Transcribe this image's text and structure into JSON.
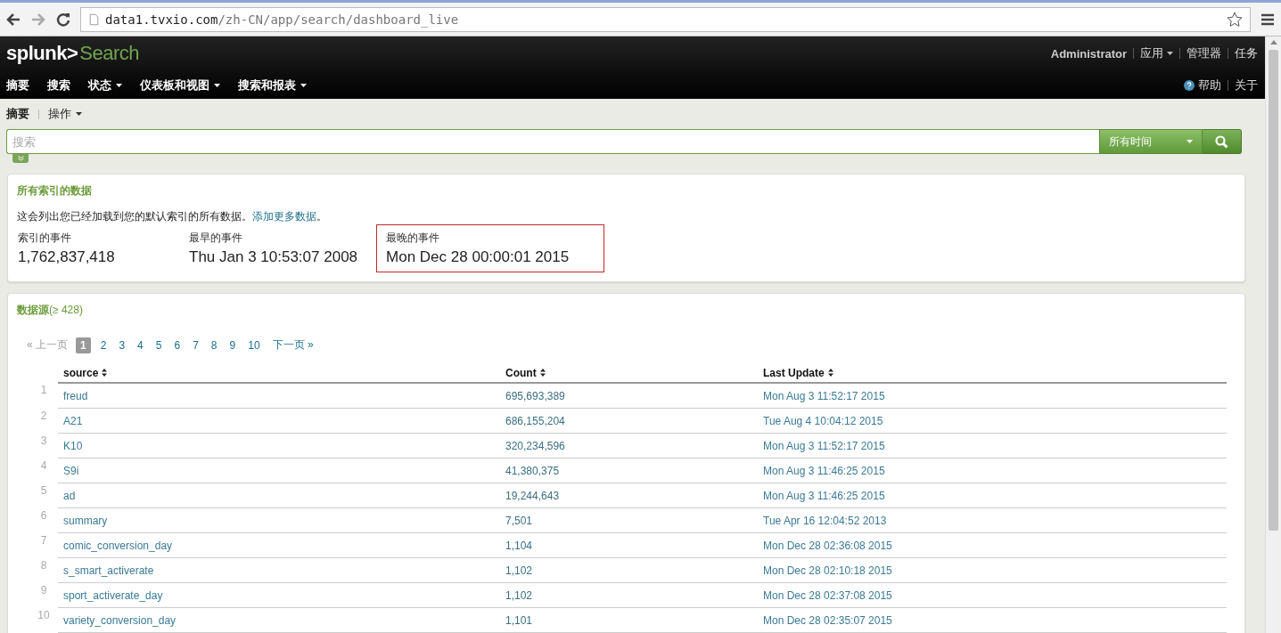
{
  "browser": {
    "url_host": "data1.tvxio.com",
    "url_path": "/zh-CN/app/search/dashboard_live"
  },
  "header": {
    "brand": "splunk>",
    "app": "Search",
    "user_links": [
      {
        "label": "Administrator",
        "kind": "user"
      },
      {
        "label": "应用",
        "kind": "menu"
      },
      {
        "label": "管理器",
        "kind": "link"
      },
      {
        "label": "任务",
        "kind": "link"
      }
    ],
    "nav": [
      {
        "label": "摘要",
        "dropdown": false
      },
      {
        "label": "搜索",
        "dropdown": false
      },
      {
        "label": "状态",
        "dropdown": true
      },
      {
        "label": "仪表板和视图",
        "dropdown": true
      },
      {
        "label": "搜索和报表",
        "dropdown": true
      }
    ],
    "help_links": [
      {
        "label": "帮助",
        "kind": "help"
      },
      {
        "label": "关于",
        "kind": "link"
      }
    ]
  },
  "subnav": [
    {
      "label": "摘要",
      "dropdown": false
    },
    {
      "label": "操作",
      "dropdown": true
    }
  ],
  "search": {
    "placeholder": "搜索",
    "time_range": "所有时间",
    "options_expanded": false
  },
  "summary": {
    "title": "所有索引的数据",
    "description": "这会列出您已经加载到您的默认索引的所有数据。",
    "link": "添加更多数据",
    "link_suffix": "。",
    "stats": [
      {
        "label": "索引的事件",
        "value": "1,762,837,418",
        "highlighted": false
      },
      {
        "label": "最早的事件",
        "value": "Thu Jan 3 10:53:07 2008",
        "highlighted": false
      },
      {
        "label": "最晚的事件",
        "value": "Mon Dec 28 00:00:01 2015",
        "highlighted": true
      }
    ]
  },
  "sources": {
    "title": "数据源",
    "count": "(≥ 428)",
    "pagination": {
      "prev": {
        "label": "« 上一页",
        "disabled": true
      },
      "pages": [
        {
          "label": "1",
          "selected": true
        },
        {
          "label": "2",
          "selected": false
        },
        {
          "label": "3",
          "selected": false
        },
        {
          "label": "4",
          "selected": false
        },
        {
          "label": "5",
          "selected": false
        },
        {
          "label": "6",
          "selected": false
        },
        {
          "label": "7",
          "selected": false
        },
        {
          "label": "8",
          "selected": false
        },
        {
          "label": "9",
          "selected": false
        },
        {
          "label": "10",
          "selected": false
        }
      ],
      "next": {
        "label": "下一页 »",
        "disabled": false
      }
    },
    "columns": [
      "source",
      "Count",
      "Last Update"
    ],
    "rows": [
      {
        "index": "1",
        "source": "freud",
        "count": "695,693,389",
        "last_update": "Mon Aug 3 11:52:17 2015"
      },
      {
        "index": "2",
        "source": "A21",
        "count": "686,155,204",
        "last_update": "Tue Aug 4 10:04:12 2015"
      },
      {
        "index": "3",
        "source": "K10",
        "count": "320,234,596",
        "last_update": "Mon Aug 3 11:52:17 2015"
      },
      {
        "index": "4",
        "source": "S9i",
        "count": "41,380,375",
        "last_update": "Mon Aug 3 11:46:25 2015"
      },
      {
        "index": "5",
        "source": "ad",
        "count": "19,244,643",
        "last_update": "Mon Aug 3 11:46:25 2015"
      },
      {
        "index": "6",
        "source": "summary",
        "count": "7,501",
        "last_update": "Tue Apr 16 12:04:52 2013"
      },
      {
        "index": "7",
        "source": "comic_conversion_day",
        "count": "1,104",
        "last_update": "Mon Dec 28 02:36:08 2015"
      },
      {
        "index": "8",
        "source": "s_smart_activerate",
        "count": "1,102",
        "last_update": "Mon Dec 28 02:10:18 2015"
      },
      {
        "index": "9",
        "source": "sport_activerate_day",
        "count": "1,102",
        "last_update": "Mon Dec 28 02:37:08 2015"
      },
      {
        "index": "10",
        "source": "variety_conversion_day",
        "count": "1,101",
        "last_update": "Mon Dec 28 02:35:07 2015"
      }
    ]
  }
}
